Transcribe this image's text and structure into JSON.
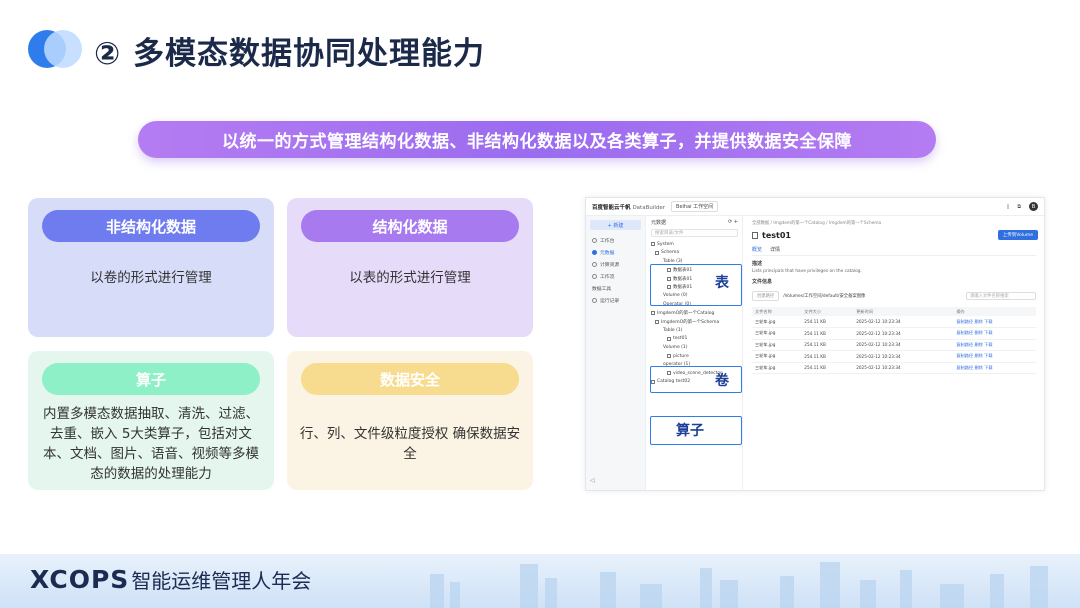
{
  "title": "② 多模态数据协同处理能力",
  "banner": "以统一的方式管理结构化数据、非结构化数据以及各类算子，并提供数据安全保障",
  "cards": [
    {
      "label": "非结构化数据",
      "text": "以卷的形式进行管理"
    },
    {
      "label": "结构化数据",
      "text": "以表的形式进行管理"
    },
    {
      "label": "算子",
      "text": "内置多模态数据抽取、清洗、过滤、去重、嵌入 5大类算子，包括对文本、文档、图片、语音、视频等多模态的数据的处理能力"
    },
    {
      "label": "数据安全",
      "text": "行、列、文件级粒度授权 确保数据安全"
    }
  ],
  "colors": {
    "title": "#1c2a4a",
    "banner": "#9a6cf0",
    "highlight": "#2f7dec"
  },
  "screenshot": {
    "brand": "百度智能云千帆",
    "product": "DataBuilder",
    "workspace": "Beihai 工作空间",
    "avatar": "B",
    "new_button": "+ 新建",
    "nav": [
      "工作台",
      "元数据",
      "计算资源",
      "工作流",
      "数据工具",
      "运行记录"
    ],
    "tree_title": "元数据",
    "tree_search": "搜索目录/文件",
    "tree": [
      "System",
      "Schema",
      "Table (3)",
      "数据表01",
      "数据表01",
      "数据表01",
      "Volume (0)",
      "Operator (0)",
      "ImgdemO的第一个Catalog",
      "ImgdemO的第一个Schema",
      "Table (1)",
      "test01",
      "Volume (1)",
      "picture",
      "operator (1)",
      "video_scene_detector",
      "Catalog test02"
    ],
    "highlight_labels": [
      "表",
      "卷",
      "算子"
    ],
    "breadcrumb": "全部数据 / Imgdem的第一个Catalog / Imgdem的第一个Schema",
    "main_title": "test01",
    "upload_button": "上传到Volume",
    "tabs": [
      "概览",
      "详情"
    ],
    "desc_label": "描述",
    "desc_text": "Lists principals that have privileges on the catalog.",
    "files_label": "文件信息",
    "path_button": "创建路径",
    "path": "/Volumes/工作空间/default/安全备案图像",
    "search_placeholder": "请输入文件名称搜索",
    "columns": [
      "文件名称",
      "文件大小",
      "更新时间",
      "操作"
    ],
    "rows": [
      {
        "name": "三轮车.jpg",
        "size": "254.11 KB",
        "time": "2025-02-12 10:23:34",
        "ops": "复制路径  删除  下载"
      },
      {
        "name": "三轮车.jpg",
        "size": "254.11 KB",
        "time": "2025-02-12 10:23:34",
        "ops": "复制路径  删除  下载"
      },
      {
        "name": "三轮车.jpg",
        "size": "254.11 KB",
        "time": "2025-02-12 10:23:34",
        "ops": "复制路径  删除  下载"
      },
      {
        "name": "三轮车.jpg",
        "size": "254.11 KB",
        "time": "2025-02-12 10:23:34",
        "ops": "复制路径  删除  下载"
      },
      {
        "name": "三轮车.jpg",
        "size": "254.11 KB",
        "time": "2025-02-12 10:23:34",
        "ops": "复制路径  删除  下载"
      }
    ]
  },
  "footer": {
    "brand": "XCOPS",
    "event": "智能运维管理人年会"
  }
}
